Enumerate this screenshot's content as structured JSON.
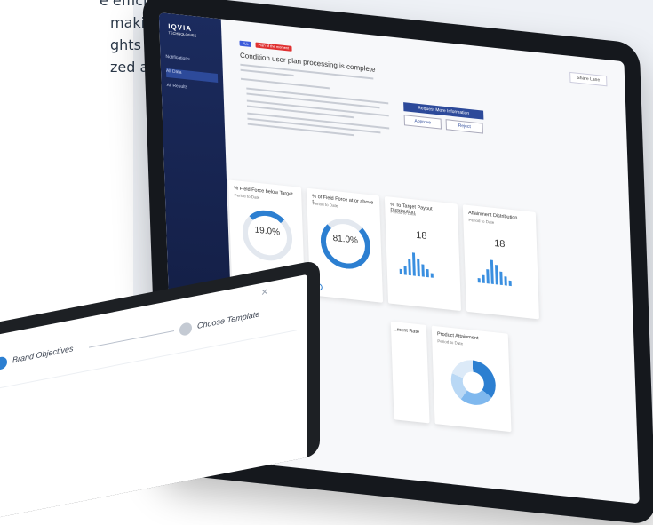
{
  "marketing": {
    "lines": [
      "e efficient",
      "making",
      "ghts and",
      "zed actions"
    ]
  },
  "tablet": {
    "brand": "IQVIA",
    "brand_sub": "TECHNOLOGIES",
    "nav": [
      "Notifications",
      "All Data",
      "All Results"
    ],
    "badges": [
      "ALL",
      "Plan of the moment"
    ],
    "header_button": "Share Lane",
    "heading": "Condition user plan processing is complete",
    "buttons": {
      "request": "Request More Information",
      "approve": "Approve",
      "reject": "Reject"
    },
    "cards": [
      {
        "title": "% Field Force below Target",
        "subtitle": "Period to Date",
        "value": "19.0%",
        "kind": "ring",
        "fraction": 0.19
      },
      {
        "title": "% of Field Force at or above t...",
        "subtitle": "Period to Date",
        "value": "81.0%",
        "kind": "ring",
        "fraction": 0.81
      },
      {
        "title": "% To Target Payout Distribution",
        "subtitle": "Period to Date",
        "value": "18",
        "kind": "bars"
      },
      {
        "title": "Attainment Distribution",
        "subtitle": "Period to Date",
        "value": "18",
        "kind": "bars"
      },
      {
        "title": "Product Attainment",
        "subtitle": "Period to Date",
        "kind": "donut"
      }
    ],
    "partial_card_title": "...ment Rate"
  },
  "laptop": {
    "steps": [
      "Brand Objectives",
      "Choose Template"
    ],
    "close_icon": "close-icon"
  },
  "colors": {
    "sidebar": "#1b2b5e",
    "accent": "#2c7fd1",
    "badge_blue": "#3b5bdb",
    "badge_red": "#e03131"
  }
}
